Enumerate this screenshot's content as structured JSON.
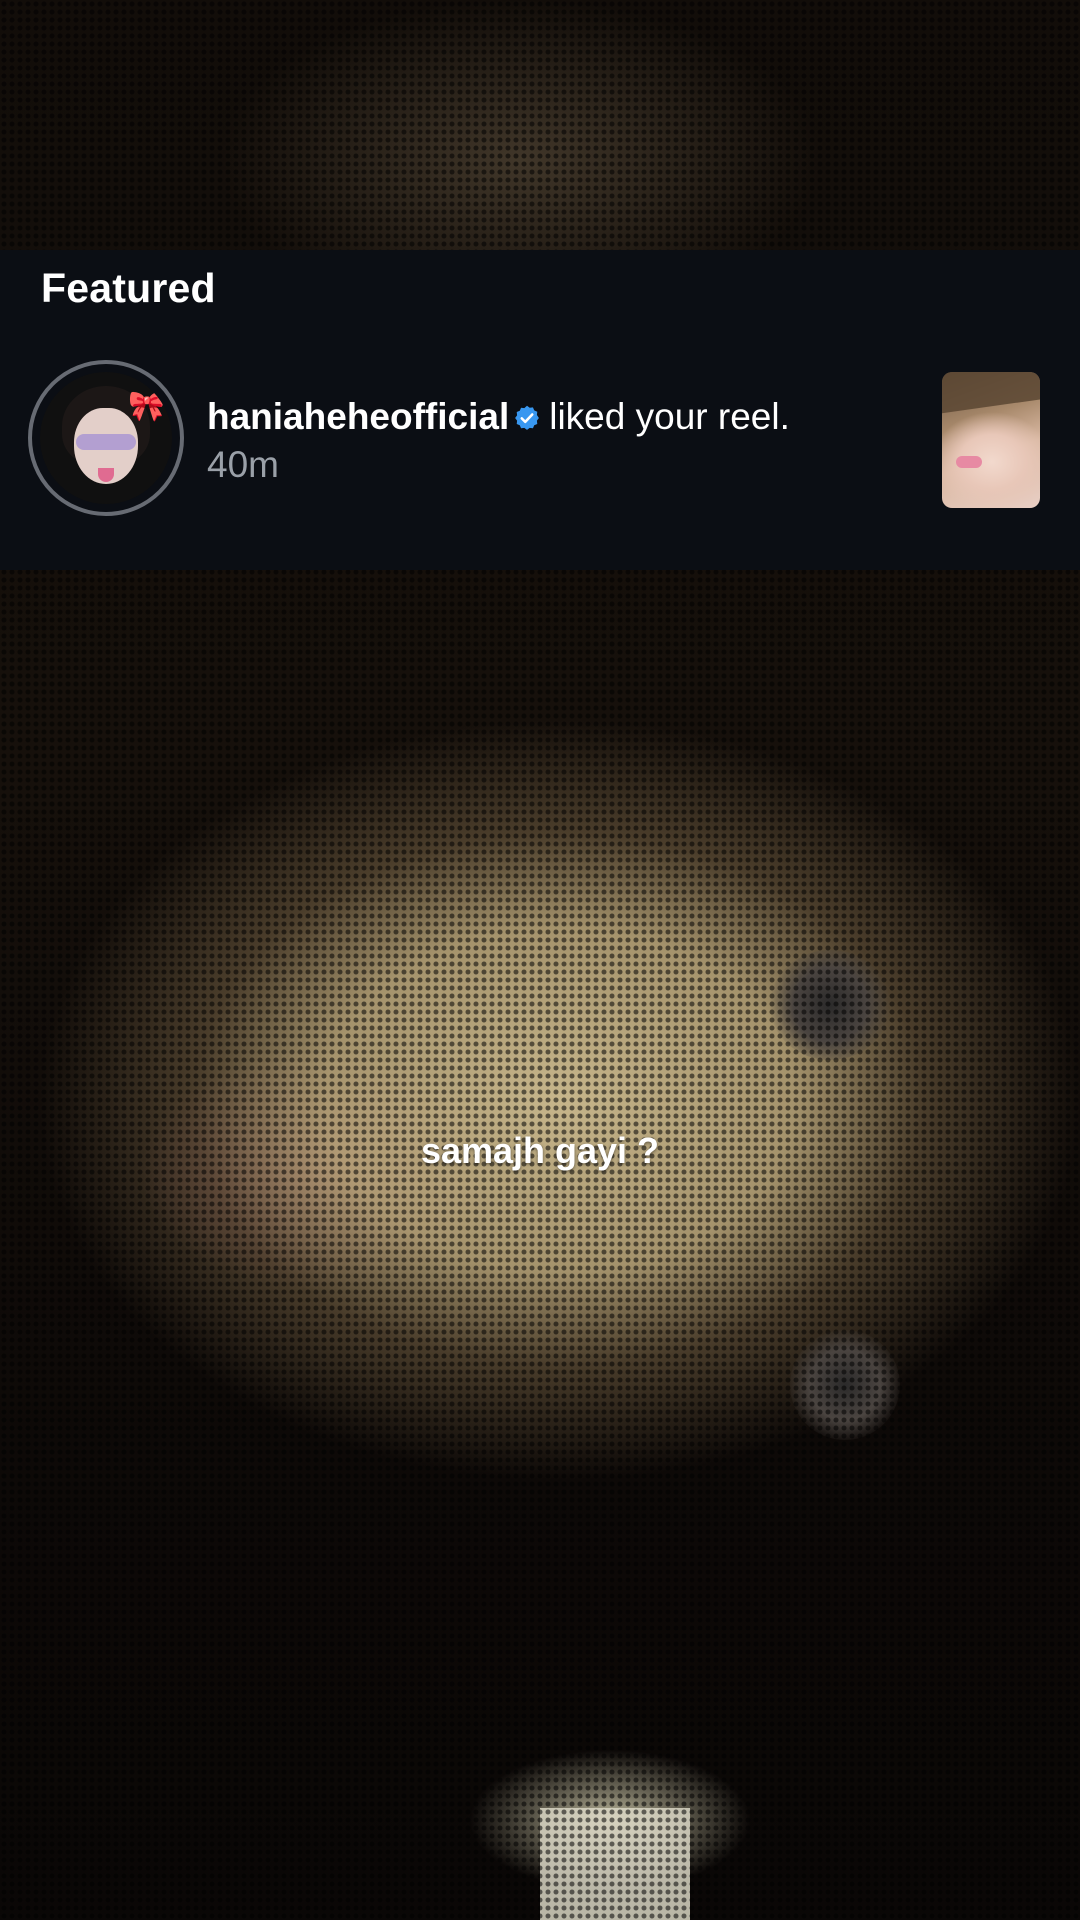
{
  "notification": {
    "section_title": "Featured",
    "username": "haniaheheofficial",
    "verified_icon": "verified-badge-icon",
    "action": "liked your reel.",
    "time": "40m",
    "accent_color": "#3897f0"
  },
  "reel": {
    "caption": "samajh gayi ?"
  }
}
